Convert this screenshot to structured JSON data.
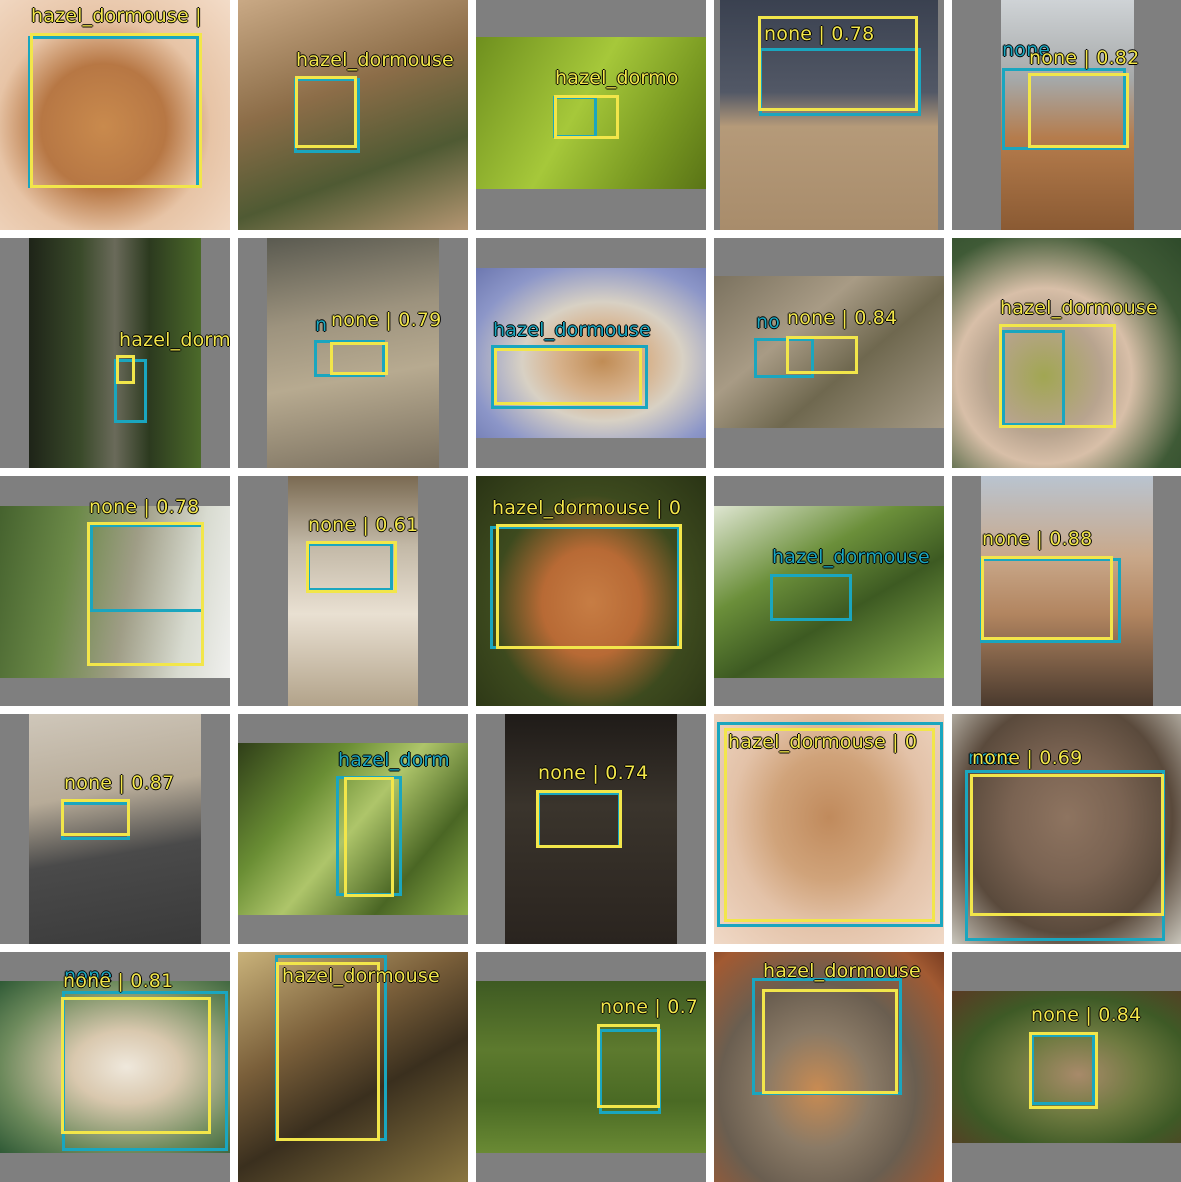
{
  "grid": {
    "tiles": [
      {
        "bg": "#c99766",
        "gt_label": "",
        "pred_label": "hazel_dormouse |"
      },
      {
        "bg": "#8c7a55",
        "gt_label": "",
        "pred_label": "hazel_dormouse"
      },
      {
        "bg": "#8fae2f",
        "gt_label": "",
        "pred_label": "hazel_dormo"
      },
      {
        "bg": "#6d6a66",
        "gt_label": "",
        "pred_label": "none | 0.78"
      },
      {
        "bg": "#9c7a5c",
        "gt_label": "none",
        "pred_label": "none | 0.82"
      },
      {
        "bg": "#2d3426",
        "gt_label": "",
        "pred_label": "hazel_dorm"
      },
      {
        "bg": "#7f7564",
        "gt_label": "n",
        "pred_label": "none | 0.79"
      },
      {
        "bg": "#9aa0b8",
        "gt_label": "hazel_dormouse",
        "pred_label": ""
      },
      {
        "bg": "#8f8777",
        "gt_label": "no",
        "pred_label": "none | 0.84"
      },
      {
        "bg": "#6b7350",
        "gt_label": "",
        "pred_label": "hazel_dormouse"
      },
      {
        "bg": "#6c8a4c",
        "gt_label": "",
        "pred_label": "none | 0.78"
      },
      {
        "bg": "#a89a86",
        "gt_label": "",
        "pred_label": "none | 0.61"
      },
      {
        "bg": "#5d5a2e",
        "gt_label": "",
        "pred_label": "hazel_dormouse | 0"
      },
      {
        "bg": "#5f7a3c",
        "gt_label": "hazel_dormouse",
        "pred_label": ""
      },
      {
        "bg": "#a58d7a",
        "gt_label": "",
        "pred_label": "none | 0.88"
      },
      {
        "bg": "#86827a",
        "gt_label": "",
        "pred_label": "none | 0.87"
      },
      {
        "bg": "#5c7034",
        "gt_label": "hazel_dorm",
        "pred_label": ""
      },
      {
        "bg": "#2a2520",
        "gt_label": "",
        "pred_label": "none | 0.74"
      },
      {
        "bg": "#d2a47c",
        "gt_label": "",
        "pred_label": "hazel_dormouse | 0"
      },
      {
        "bg": "#8b7a64",
        "gt_label": "none",
        "pred_label": "none | 0.69"
      },
      {
        "bg": "#9aa07a",
        "gt_label": "none",
        "pred_label": "none | 0.81"
      },
      {
        "bg": "#5b4a2a",
        "gt_label": "",
        "pred_label": "hazel_dormouse"
      },
      {
        "bg": "#4d6d2c",
        "gt_label": "",
        "pred_label": "none | 0.7"
      },
      {
        "bg": "#6a5e4f",
        "gt_label": "",
        "pred_label": "hazel_dormouse"
      },
      {
        "bg": "#4a5a30",
        "gt_label": "",
        "pred_label": "none | 0.84"
      }
    ]
  },
  "colors": {
    "gt": "#1aa6bf",
    "pred": "#f2e64a",
    "pad": "#7f7f7f"
  }
}
